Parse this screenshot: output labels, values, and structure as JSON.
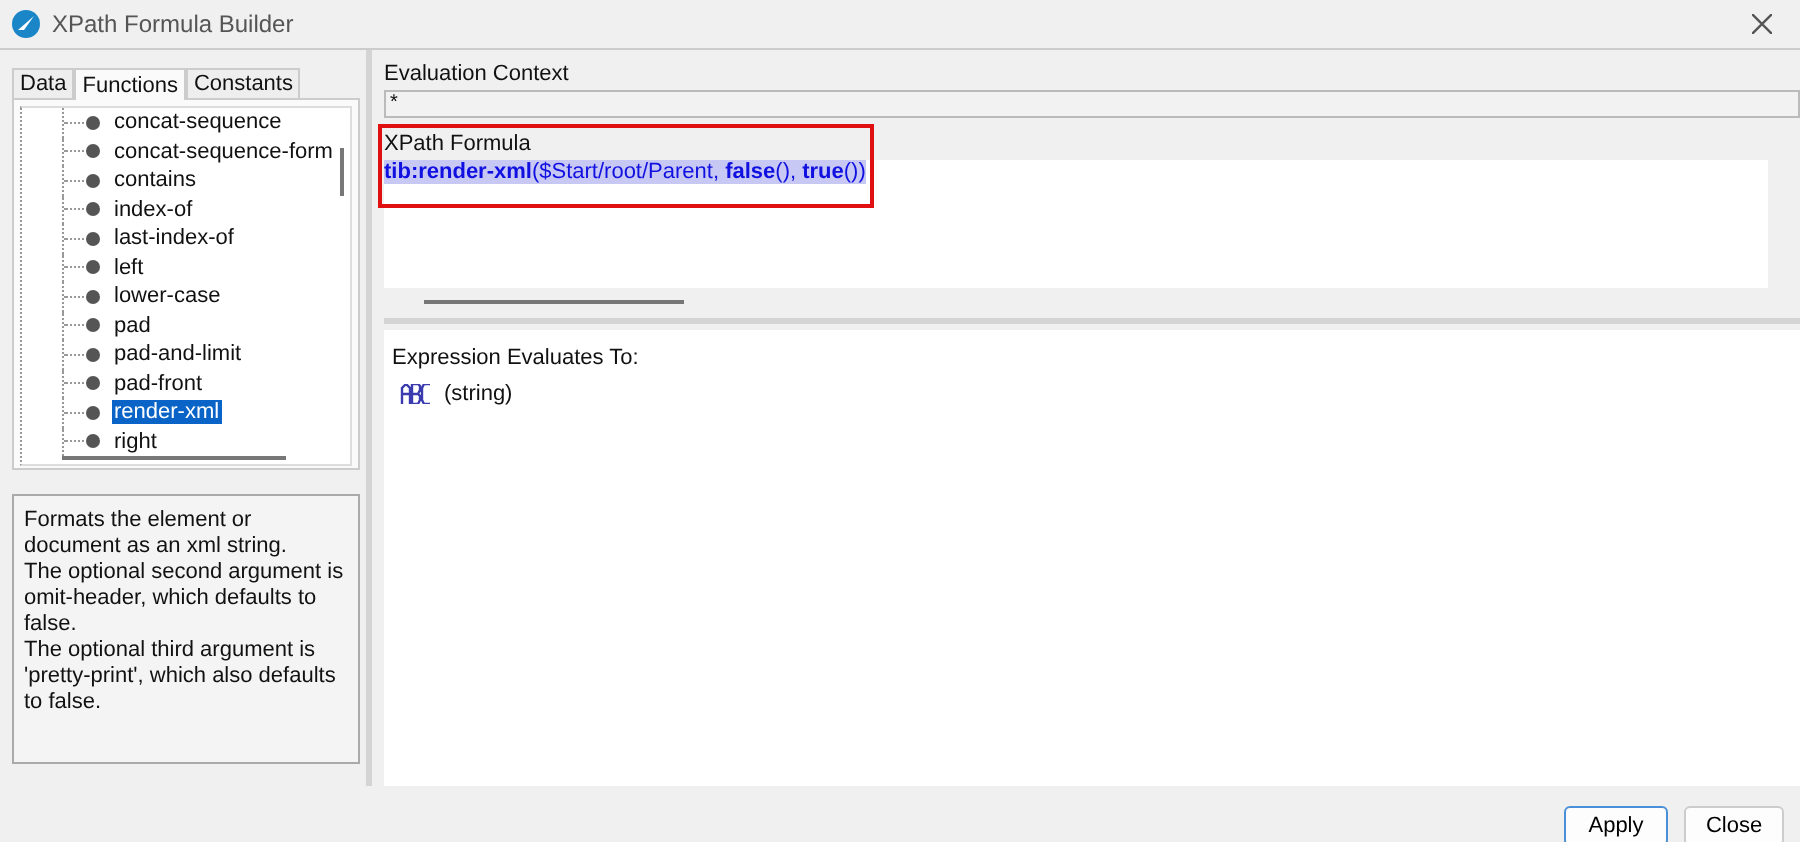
{
  "window": {
    "title": "XPath Formula Builder"
  },
  "tabs": [
    {
      "label": "Data",
      "selected": false
    },
    {
      "label": "Functions",
      "selected": true
    },
    {
      "label": "Constants",
      "selected": false
    }
  ],
  "functions": [
    {
      "label": "concat-sequence",
      "selected": false
    },
    {
      "label": "concat-sequence-form",
      "selected": false
    },
    {
      "label": "contains",
      "selected": false
    },
    {
      "label": "index-of",
      "selected": false
    },
    {
      "label": "last-index-of",
      "selected": false
    },
    {
      "label": "left",
      "selected": false
    },
    {
      "label": "lower-case",
      "selected": false
    },
    {
      "label": "pad",
      "selected": false
    },
    {
      "label": "pad-and-limit",
      "selected": false
    },
    {
      "label": "pad-front",
      "selected": false
    },
    {
      "label": "render-xml",
      "selected": true
    },
    {
      "label": "right",
      "selected": false
    }
  ],
  "description": [
    "Formats the element or document as an xml string.",
    "The optional second argument is omit-header, which defaults to false.",
    "The optional third argument is 'pretty-print', which also defaults to false."
  ],
  "evaluation_context": {
    "label": "Evaluation Context",
    "value": "*"
  },
  "formula": {
    "label": "XPath Formula",
    "value": "**tib:render-xml**($Start/root/Parent, **false**(), **true**())",
    "highlighted": true
  },
  "result": {
    "label": "Expression Evaluates To:",
    "type": "(string)"
  },
  "buttons": [
    {
      "label": "Apply",
      "kind": "default"
    },
    {
      "label": "Close",
      "kind": "plain"
    }
  ]
}
